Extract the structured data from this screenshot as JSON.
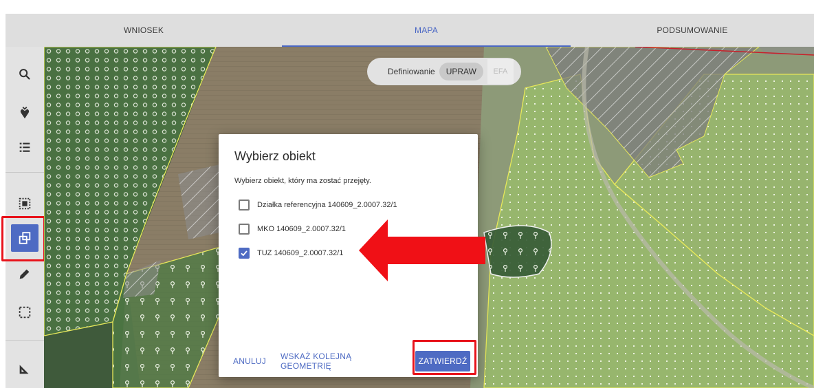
{
  "tabs": [
    {
      "label": "WNIOSEK",
      "active": false
    },
    {
      "label": "MAPA",
      "active": true
    },
    {
      "label": "PODSUMOWANIE",
      "active": false
    }
  ],
  "toolbar": {
    "tools": [
      "search-icon",
      "pin-icon",
      "list-icon",
      "select-area-icon",
      "copy-geometry-icon",
      "edit-pencil-icon",
      "selection-icon",
      "measure-icon"
    ],
    "active_tool": "copy-geometry-icon"
  },
  "mode_switch": {
    "label": "Definiowanie",
    "option_active": "UPRAW",
    "option_inactive": "EFA"
  },
  "dialog": {
    "title": "Wybierz obiekt",
    "subtitle": "Wybierz obiekt, który ma zostać przejęty.",
    "options": [
      {
        "label": "Działka referencyjna 140609_2.0007.32/1",
        "checked": false
      },
      {
        "label": "MKO 140609_2.0007.32/1",
        "checked": false
      },
      {
        "label": "TUZ 140609_2.0007.32/1",
        "checked": true
      }
    ],
    "buttons": {
      "cancel": "ANULUJ",
      "next_geometry": "WSKAŻ KOLEJNĄ GEOMETRIĘ",
      "confirm": "ZATWIERDŹ"
    }
  },
  "colors": {
    "accent": "#4e6bc3",
    "highlight_red": "#e8131b",
    "map_green_overlay": "#8fb85a"
  }
}
